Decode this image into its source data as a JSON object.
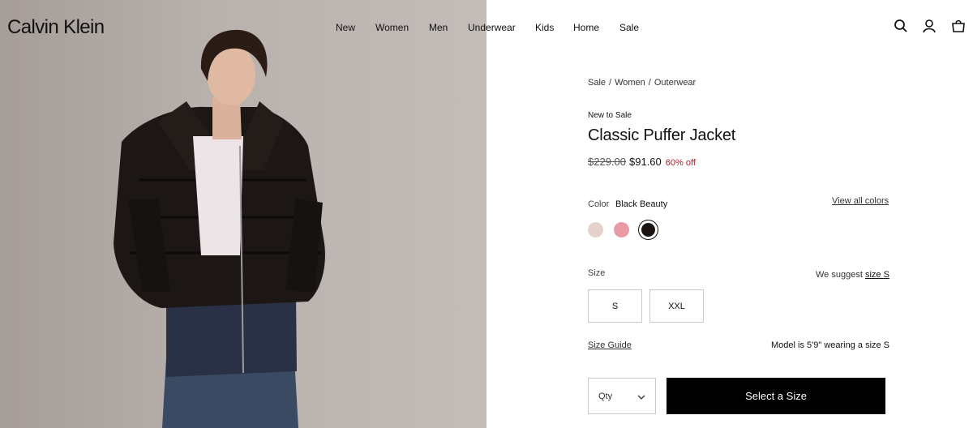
{
  "header": {
    "logo": "Calvin Klein",
    "nav": [
      "New",
      "Women",
      "Men",
      "Underwear",
      "Kids",
      "Home",
      "Sale"
    ],
    "icons": [
      "search-icon",
      "account-icon",
      "bag-icon"
    ]
  },
  "breadcrumb": [
    "Sale",
    "Women",
    "Outerwear"
  ],
  "product": {
    "badge": "New to Sale",
    "title": "Classic Puffer Jacket",
    "original_price": "$229.00",
    "sale_price": "$91.60",
    "discount": "60% off"
  },
  "color": {
    "label": "Color",
    "selected": "Black Beauty",
    "view_all": "View all colors",
    "swatches": [
      {
        "name": "light pink",
        "hex": "#e6d2cd"
      },
      {
        "name": "pink",
        "hex": "#ea9aa5"
      },
      {
        "name": "Black Beauty",
        "hex": "#1b1311",
        "selected": true
      }
    ]
  },
  "size": {
    "label": "Size",
    "suggest_prefix": "We suggest",
    "suggest_link": "size S",
    "options": [
      "S",
      "XXL"
    ],
    "guide": "Size Guide",
    "model_note": "Model is 5'9\" wearing a size S"
  },
  "purchase": {
    "qty_label": "Qty",
    "cta": "Select a Size"
  },
  "colors": {
    "sale_red": "#b0202b",
    "cta_bg": "#000000"
  }
}
